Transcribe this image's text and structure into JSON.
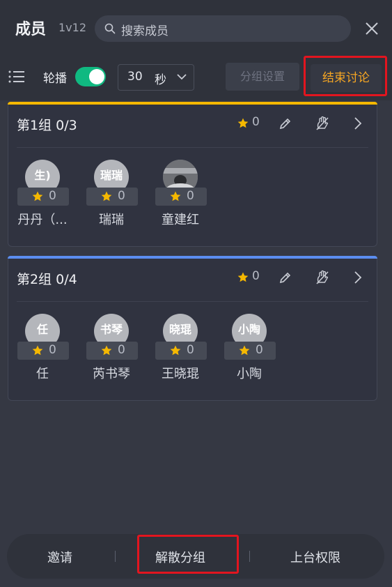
{
  "header": {
    "title": "成员",
    "subtitle": "1v12",
    "search_placeholder": "搜索成员"
  },
  "toolbar": {
    "carousel_label": "轮播",
    "carousel_enabled": true,
    "interval_value": "30",
    "interval_unit": "秒",
    "group_settings_label": "分组设置",
    "end_discussion_label": "结束讨论"
  },
  "groups": [
    {
      "title": "第1组 0/3",
      "stars": "0",
      "accent": "#f5b800",
      "members": [
        {
          "avatar_text": "生)",
          "score": "0",
          "name": "丹丹（..."
        },
        {
          "avatar_text": "瑞瑞",
          "score": "0",
          "name": "瑞瑞"
        },
        {
          "avatar_text": "",
          "score": "0",
          "name": "童建红"
        }
      ]
    },
    {
      "title": "第2组 0/4",
      "stars": "0",
      "accent": "#5b8def",
      "members": [
        {
          "avatar_text": "任",
          "score": "0",
          "name": "任"
        },
        {
          "avatar_text": "书琴",
          "score": "0",
          "name": "芮书琴"
        },
        {
          "avatar_text": "晓琨",
          "score": "0",
          "name": "王晓琨"
        },
        {
          "avatar_text": "小陶",
          "score": "0",
          "name": "小陶"
        }
      ]
    }
  ],
  "bottom_bar": {
    "invite_label": "邀请",
    "dissolve_label": "解散分组",
    "stage_label": "上台权限"
  },
  "colors": {
    "highlight": "#e2151f",
    "accent_orange": "#f6a623",
    "toggle_on": "#10b981"
  }
}
